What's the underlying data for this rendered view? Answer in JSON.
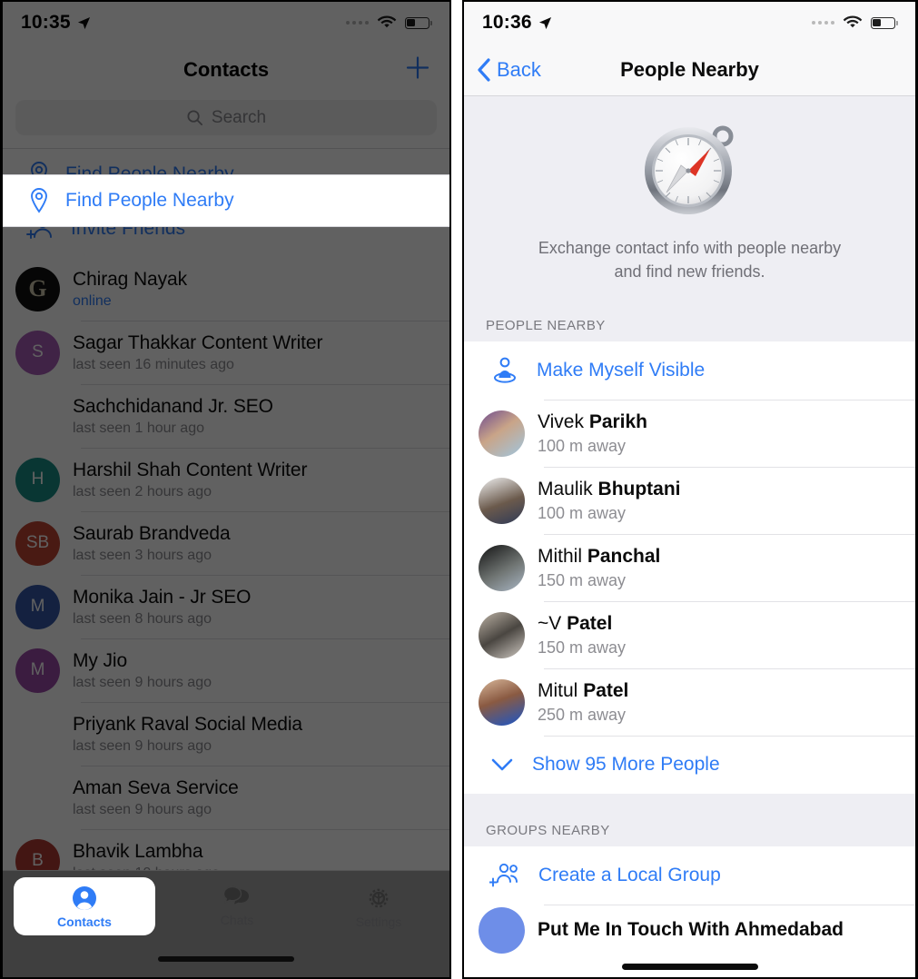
{
  "left_phone": {
    "status_bar": {
      "time": "10:35",
      "location_icon": "location-arrow-icon",
      "wifi_icon": "wifi-icon",
      "battery_icon": "battery-icon"
    },
    "nav": {
      "title": "Contacts",
      "add_icon": "plus-icon"
    },
    "search": {
      "placeholder": "Search",
      "icon": "search-icon"
    },
    "find_people_nearby": {
      "label": "Find People Nearby",
      "icon": "location-pin-icon"
    },
    "invite_friends": {
      "label": "Invite Friends",
      "icon": "person-add-icon"
    },
    "contacts": [
      {
        "name": "Chirag Nayak",
        "status": "online",
        "online": true,
        "avatar_type": "logo",
        "avatar_text": "G",
        "avatar_color": "#111111"
      },
      {
        "name": "Sagar Thakkar Content Writer",
        "status": "last seen 16 minutes ago",
        "online": false,
        "avatar_type": "initials",
        "avatar_text": "S",
        "avatar_color": "#a85cb8"
      },
      {
        "name": "Sachchidanand Jr. SEO",
        "status": "last seen 1 hour ago",
        "online": false,
        "avatar_type": "none",
        "avatar_text": "",
        "avatar_color": ""
      },
      {
        "name": "Harshil Shah Content Writer",
        "status": "last seen 2 hours ago",
        "online": false,
        "avatar_type": "initials",
        "avatar_text": "H",
        "avatar_color": "#1a8f86"
      },
      {
        "name": "Saurab Brandveda",
        "status": "last seen 3 hours ago",
        "online": false,
        "avatar_type": "initials",
        "avatar_text": "SB",
        "avatar_color": "#bf4433"
      },
      {
        "name": "Monika Jain - Jr SEO",
        "status": "last seen 8 hours ago",
        "online": false,
        "avatar_type": "initials",
        "avatar_text": "M",
        "avatar_color": "#3558a8"
      },
      {
        "name": "My Jio",
        "status": "last seen 9 hours ago",
        "online": false,
        "avatar_type": "initials",
        "avatar_text": "M",
        "avatar_color": "#9b4aa8"
      },
      {
        "name": "Priyank Raval Social Media",
        "status": "last seen 9 hours ago",
        "online": false,
        "avatar_type": "none",
        "avatar_text": "",
        "avatar_color": ""
      },
      {
        "name": "Aman Seva Service",
        "status": "last seen 9 hours ago",
        "online": false,
        "avatar_type": "none",
        "avatar_text": "",
        "avatar_color": ""
      },
      {
        "name": "Bhavik Lambha",
        "status": "last seen 10 hours ago",
        "online": false,
        "avatar_type": "initials",
        "avatar_text": "B",
        "avatar_color": "#b03a33"
      }
    ],
    "tabbar": [
      {
        "label": "Contacts",
        "icon": "person-circle-icon",
        "active": true
      },
      {
        "label": "Chats",
        "icon": "chat-bubbles-icon",
        "active": false
      },
      {
        "label": "Settings",
        "icon": "gear-icon",
        "active": false
      }
    ]
  },
  "right_phone": {
    "status_bar": {
      "time": "10:36",
      "location_icon": "location-arrow-icon",
      "wifi_icon": "wifi-icon",
      "battery_icon": "battery-icon"
    },
    "nav": {
      "back_label": "Back",
      "back_icon": "chevron-left-icon",
      "title": "People Nearby"
    },
    "hero": {
      "icon": "compass-icon",
      "description_line1": "Exchange contact info with people nearby",
      "description_line2": "and find new friends."
    },
    "people_section": {
      "header": "PEOPLE NEARBY",
      "make_visible": {
        "label": "Make Myself Visible",
        "icon": "person-on-location-icon"
      },
      "people": [
        {
          "first": "Vivek ",
          "last": "Parikh",
          "distance": "100 m away"
        },
        {
          "first": "Maulik ",
          "last": "Bhuptani",
          "distance": "100 m away"
        },
        {
          "first": "Mithil ",
          "last": "Panchal",
          "distance": "150 m away"
        },
        {
          "first": "~V ",
          "last": "Patel",
          "distance": "150 m away"
        },
        {
          "first": "Mitul ",
          "last": "Patel",
          "distance": "250 m away"
        }
      ],
      "show_more": {
        "label": "Show 95 More People",
        "icon": "chevron-down-icon"
      }
    },
    "groups_section": {
      "header": "GROUPS NEARBY",
      "create_group": {
        "label": "Create a Local Group",
        "icon": "group-add-icon"
      },
      "groups": [
        {
          "name": "Put Me In Touch With Ahmedabad"
        }
      ]
    }
  },
  "colors": {
    "accent_blue": "#2f7cf6",
    "section_bg": "#eeeef3",
    "secondary_text": "#8d8d92"
  }
}
